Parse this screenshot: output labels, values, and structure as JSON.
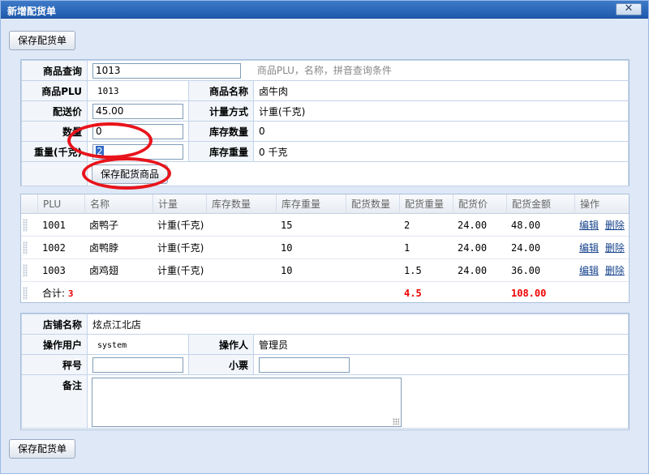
{
  "window": {
    "title": "新增配货单",
    "close": "✕"
  },
  "toolbar": {
    "save_label": "保存配货单"
  },
  "query": {
    "label": "商品查询",
    "value": "1013",
    "hint": "商品PLU，名称，拼音查询条件"
  },
  "item": {
    "plu_label": "商品PLU",
    "plu_value": "1013",
    "name_label": "商品名称",
    "name_value": "卤牛肉",
    "price_label": "配送价",
    "price_value": "45.00",
    "measure_label": "计量方式",
    "measure_value": "计重(千克)",
    "qty_label": "数量",
    "qty_value": "0",
    "stock_qty_label": "库存数量",
    "stock_qty_value": "0",
    "weight_label": "重量(千克)",
    "weight_value": "2",
    "stock_weight_label": "库存重量",
    "stock_weight_value": "0 千克",
    "save_item_label": "保存配货商品"
  },
  "grid": {
    "headers": [
      "PLU",
      "名称",
      "计量",
      "库存数量",
      "库存重量",
      "配货数量",
      "配货重量",
      "配货价",
      "配货金额",
      "操作"
    ],
    "rows": [
      {
        "plu": "1001",
        "name": "卤鸭子",
        "measure": "计重(千克)",
        "stock_qty": "",
        "stock_weight": "15",
        "qty": "",
        "weight": "2",
        "price": "24.00",
        "amount": "48.00",
        "edit": "编辑",
        "delete": "删除"
      },
      {
        "plu": "1002",
        "name": "卤鸭脖",
        "measure": "计重(千克)",
        "stock_qty": "",
        "stock_weight": "10",
        "qty": "",
        "weight": "1",
        "price": "24.00",
        "amount": "24.00",
        "edit": "编辑",
        "delete": "删除"
      },
      {
        "plu": "1003",
        "name": "卤鸡翅",
        "measure": "计重(千克)",
        "stock_qty": "",
        "stock_weight": "10",
        "qty": "",
        "weight": "1.5",
        "price": "24.00",
        "amount": "36.00",
        "edit": "编辑",
        "delete": "删除"
      }
    ],
    "summary": {
      "label": "合计:",
      "count": "3",
      "weight": "4.5",
      "amount": "108.00"
    }
  },
  "store": {
    "store_label": "店铺名称",
    "store_value": "炫点江北店",
    "user_label": "操作用户",
    "user_value": "system",
    "operator_label": "操作人",
    "operator_value": "管理员",
    "scale_label": "秤号",
    "scale_value": "",
    "ticket_label": "小票",
    "ticket_value": "",
    "note_label": "备注",
    "note_value": ""
  },
  "colors": {
    "title_bar": "#1f5aad",
    "accent_red": "#e8141b",
    "link": "#15428b"
  }
}
